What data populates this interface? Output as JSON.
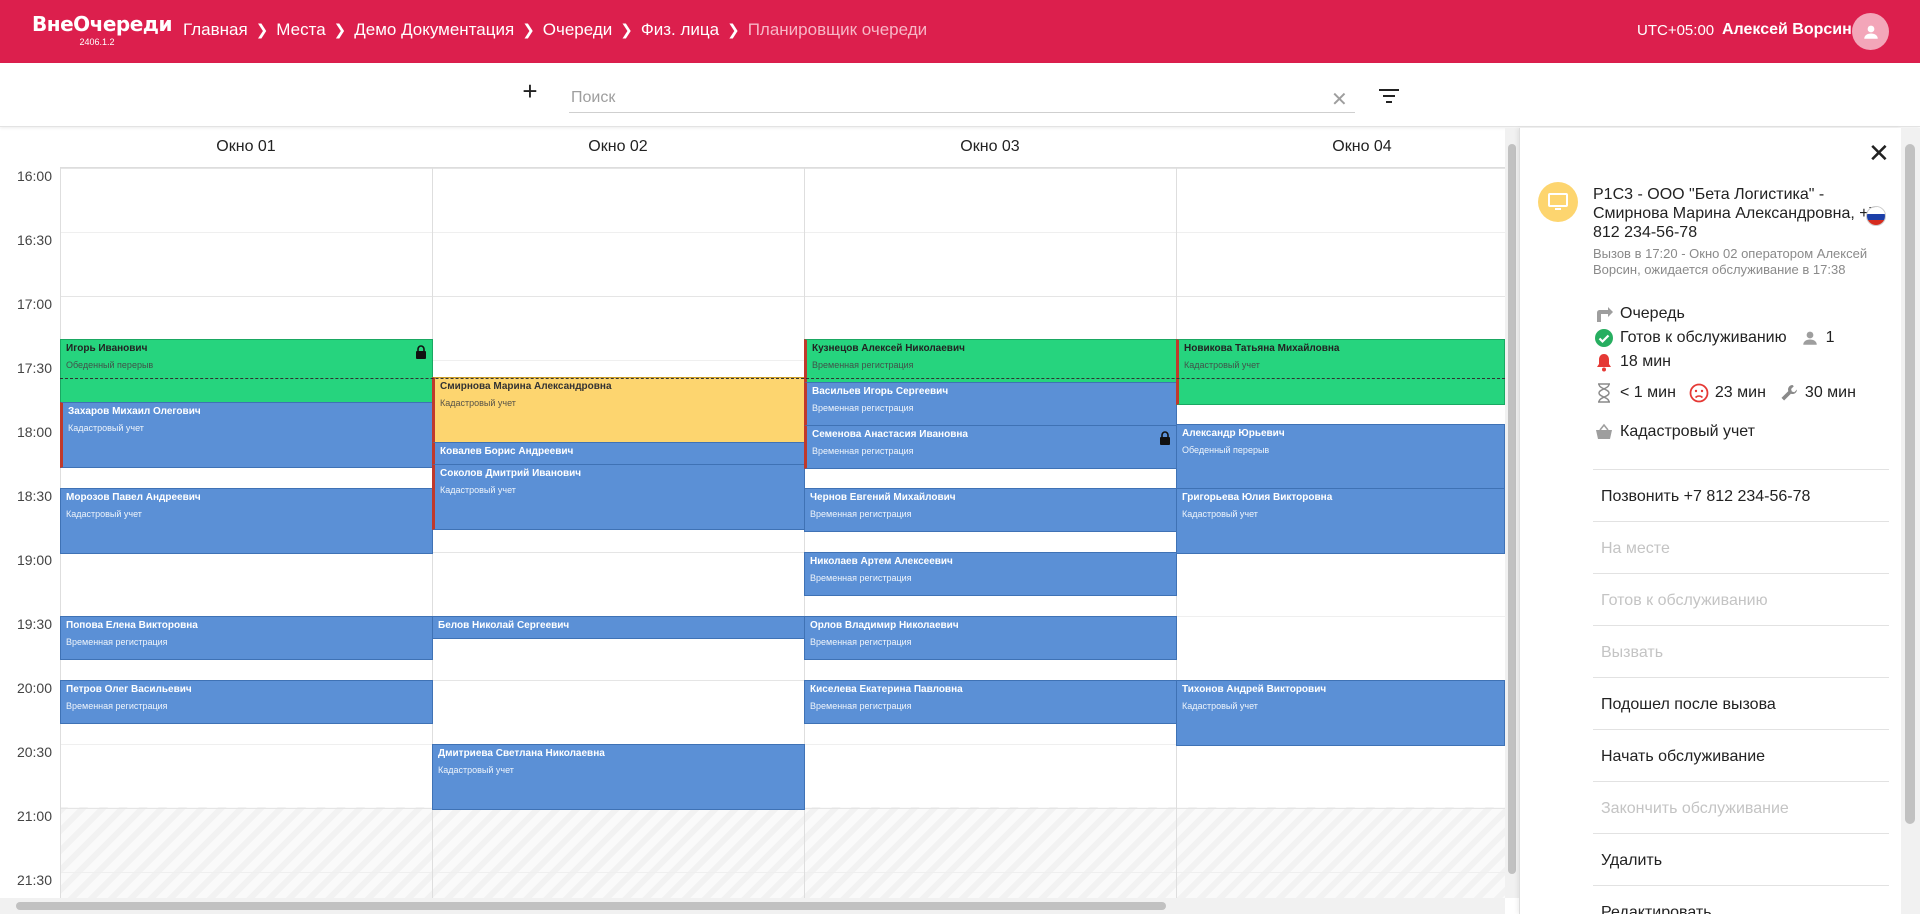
{
  "header": {
    "logo": "ВнеОчереди",
    "version": "2406.1.2",
    "breadcrumbs": [
      "Главная",
      "Места",
      "Демо Документация",
      "Очереди",
      "Физ. лица",
      "Планировщик очереди"
    ],
    "timezone": "UTC+05:00",
    "user": "Алексей Ворсин"
  },
  "toolbar": {
    "search_placeholder": "Поиск",
    "add_label": "+",
    "clear_label": "✕"
  },
  "scheduler": {
    "columns": [
      "Окно 01",
      "Окно 02",
      "Окно 03",
      "Окно 04"
    ],
    "times": [
      "16:00",
      "16:30",
      "17:00",
      "17:30",
      "18:00",
      "18:30",
      "19:00",
      "19:30",
      "20:00",
      "20:30",
      "21:00",
      "21:30"
    ],
    "events": [
      {
        "name": "Игорь Иванович",
        "service": "Обеденный перерыв",
        "color": "green",
        "locked": true
      },
      {
        "name": "Захаров Михаил Олегович",
        "service": "Кадастровый учет",
        "color": "blue"
      },
      {
        "name": "Морозов Павел Андреевич",
        "service": "Кадастровый учет",
        "color": "blue"
      },
      {
        "name": "Попова Елена Викторовна",
        "service": "Временная регистрация",
        "color": "blue"
      },
      {
        "name": "Петров Олег Васильевич",
        "service": "Временная регистрация",
        "color": "blue"
      },
      {
        "name": "Смирнова Марина Александровна",
        "service": "Кадастровый учет",
        "color": "yellow"
      },
      {
        "name": "Ковалев Борис Андреевич",
        "service": "",
        "color": "blue"
      },
      {
        "name": "Соколов Дмитрий Иванович",
        "service": "Кадастровый учет",
        "color": "blue"
      },
      {
        "name": "Белов Николай Сергеевич",
        "service": "",
        "color": "blue"
      },
      {
        "name": "Дмитриева Светлана Николаевна",
        "service": "Кадастровый учет",
        "color": "blue"
      },
      {
        "name": "Кузнецов Алексей Николаевич",
        "service": "Временная регистрация",
        "color": "green"
      },
      {
        "name": "Васильев Игорь Сергеевич",
        "service": "Временная регистрация",
        "color": "blue"
      },
      {
        "name": "Семенова Анастасия Ивановна",
        "service": "Временная регистрация",
        "color": "blue",
        "locked": true
      },
      {
        "name": "Чернов Евгений Михайлович",
        "service": "Временная регистрация",
        "color": "blue"
      },
      {
        "name": "Николаев Артем Алексеевич",
        "service": "Временная регистрация",
        "color": "blue"
      },
      {
        "name": "Орлов Владимир Николаевич",
        "service": "Временная регистрация",
        "color": "blue"
      },
      {
        "name": "Киселева Екатерина Павловна",
        "service": "Временная регистрация",
        "color": "blue"
      },
      {
        "name": "Новикова Татьяна Михайловна",
        "service": "Кадастровый учет",
        "color": "green"
      },
      {
        "name": "Александр Юрьевич",
        "service": "Обеденный перерыв",
        "color": "blue"
      },
      {
        "name": "Григорьева Юлия Викторовна",
        "service": "Кадастровый учет",
        "color": "blue"
      },
      {
        "name": "Тихонов Андрей Викторович",
        "service": "Кадастровый учет",
        "color": "blue"
      }
    ]
  },
  "panel": {
    "title": "P1C3 - ООО \"Бета Логистика\" - Смирнова Марина Александровна, +7 812 234-56-78",
    "subtitle": "Вызов в 17:20 - Окно 02 оператором Алексей Ворсин, ожидается обслуживание в 17:38",
    "queue": "Очередь",
    "status": "Готов к обслуживанию",
    "persons": "1",
    "wait": "18 мин",
    "t1": "< 1 мин",
    "t2": "23 мин",
    "t3": "30 мин",
    "service": "Кадастровый учет",
    "actions": [
      {
        "label": "Позвонить +7 812 234-56-78",
        "enabled": true
      },
      {
        "label": "На месте",
        "enabled": false
      },
      {
        "label": "Готов к обслуживанию",
        "enabled": false
      },
      {
        "label": "Вызвать",
        "enabled": false
      },
      {
        "label": "Подошел после вызова",
        "enabled": true
      },
      {
        "label": "Начать обслуживание",
        "enabled": true
      },
      {
        "label": "Закончить обслуживание",
        "enabled": false
      },
      {
        "label": "Удалить",
        "enabled": true
      },
      {
        "label": "Редактировать",
        "enabled": true
      }
    ],
    "colors": {
      "accent": "#dc1f4d",
      "ticket": "#fdd56f",
      "ok": "#27ae60",
      "alert": "#e53935"
    }
  }
}
